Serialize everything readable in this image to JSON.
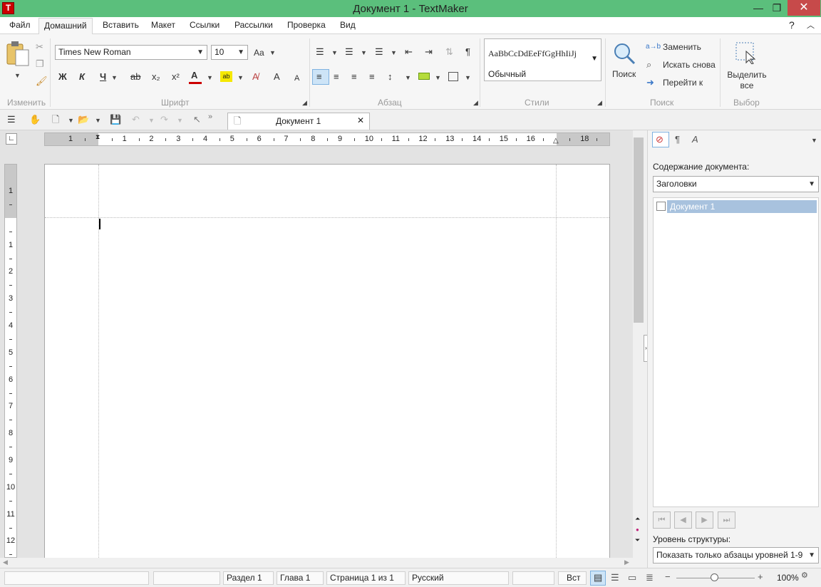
{
  "window": {
    "title": "Документ 1 - TextMaker",
    "app_icon_letter": "T"
  },
  "menu": {
    "tabs": [
      "Файл",
      "Домашний",
      "Вставить",
      "Макет",
      "Ссылки",
      "Рассылки",
      "Проверка",
      "Вид"
    ],
    "help": "?"
  },
  "ribbon": {
    "groups": {
      "edit": "Изменить",
      "font": "Шрифт",
      "paragraph": "Абзац",
      "styles": "Стили",
      "search": "Поиск",
      "select": "Выбор"
    },
    "font": {
      "name": "Times New Roman",
      "size": "10",
      "bold": "Ж",
      "italic": "К",
      "underline": "Ч",
      "strike": "ab",
      "sub": "x₂",
      "sup": "x²",
      "color": "A",
      "grow": "A",
      "shrink": "A"
    },
    "styles": {
      "preview": "AaBbCcDdEeFfGgHhIiJj",
      "current": "Обычный"
    },
    "search": {
      "search": "Поиск",
      "replace": "Заменить",
      "find_again": "Искать снова",
      "goto": "Перейти к"
    },
    "select": {
      "select_all": "Выделить все"
    }
  },
  "document": {
    "tab": "Документ 1"
  },
  "rulers": {
    "h": [
      "1",
      "",
      "1",
      "2",
      "3",
      "4",
      "5",
      "6",
      "7",
      "8",
      "9",
      "10",
      "11",
      "12",
      "13",
      "14",
      "15",
      "16",
      "",
      "18"
    ],
    "v": [
      "1",
      "",
      "1",
      "2",
      "3",
      "4",
      "5",
      "6",
      "7",
      "8",
      "9",
      "10",
      "11",
      "12"
    ]
  },
  "panel": {
    "contents_label": "Содержание документа:",
    "mode": "Заголовки",
    "items": [
      "Документ 1"
    ],
    "level_label": "Уровень структуры:",
    "level_value": "Показать только абзацы уровней 1-9"
  },
  "status": {
    "section": "Раздел 1",
    "chapter": "Глава 1",
    "page": "Страница 1 из 1",
    "language": "Русский",
    "insert_mode": "Вст",
    "zoom": "100%"
  },
  "colors": {
    "titlebar": "#5bbf7c",
    "font_color": "#cc0000",
    "highlight": "#f5e800",
    "accent": "#3a78c8"
  }
}
